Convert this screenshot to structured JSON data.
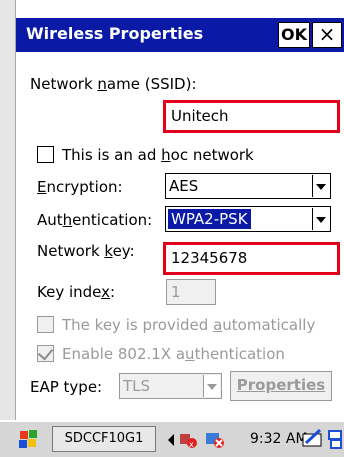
{
  "dialog": {
    "title": "Wireless Properties",
    "ok_label": "OK",
    "close_label": "×"
  },
  "form": {
    "ssid_label_pre": "Network ",
    "ssid_label_u": "n",
    "ssid_label_post": "ame (SSID):",
    "ssid_value": "Unitech",
    "adhoc_pre": "This is an ad ",
    "adhoc_u": "h",
    "adhoc_post": "oc network",
    "adhoc_checked": false,
    "encryption_label_u": "E",
    "encryption_label_post": "ncryption:",
    "encryption_value": "AES",
    "auth_label_pre": "Aut",
    "auth_label_u": "h",
    "auth_label_post": "entication:",
    "auth_value": "WPA2-PSK",
    "netkey_label_pre": "Network ",
    "netkey_label_u": "k",
    "netkey_label_post": "ey:",
    "netkey_value": "12345678",
    "keyindex_label_pre": "Key inde",
    "keyindex_label_u": "x",
    "keyindex_label_post": ":",
    "keyindex_value": "1",
    "auto_key_pre": "The key is provided ",
    "auto_key_u": "a",
    "auto_key_post": "utomatically",
    "auto_key_checked": false,
    "enable8021x_pre": "Enable 802.1X a",
    "enable8021x_u": "u",
    "enable8021x_post": "thentication",
    "enable8021x_checked": true,
    "eap_label": "EAP type:",
    "eap_value": "TLS",
    "properties_label": "Properties"
  },
  "taskbar": {
    "app_button": "SDCCF10G1",
    "time": "9:32 AM"
  },
  "colors": {
    "title_bar": "#0a1aa6",
    "highlight_box": "#e2001a",
    "selected_item": "#0a1aa6"
  }
}
